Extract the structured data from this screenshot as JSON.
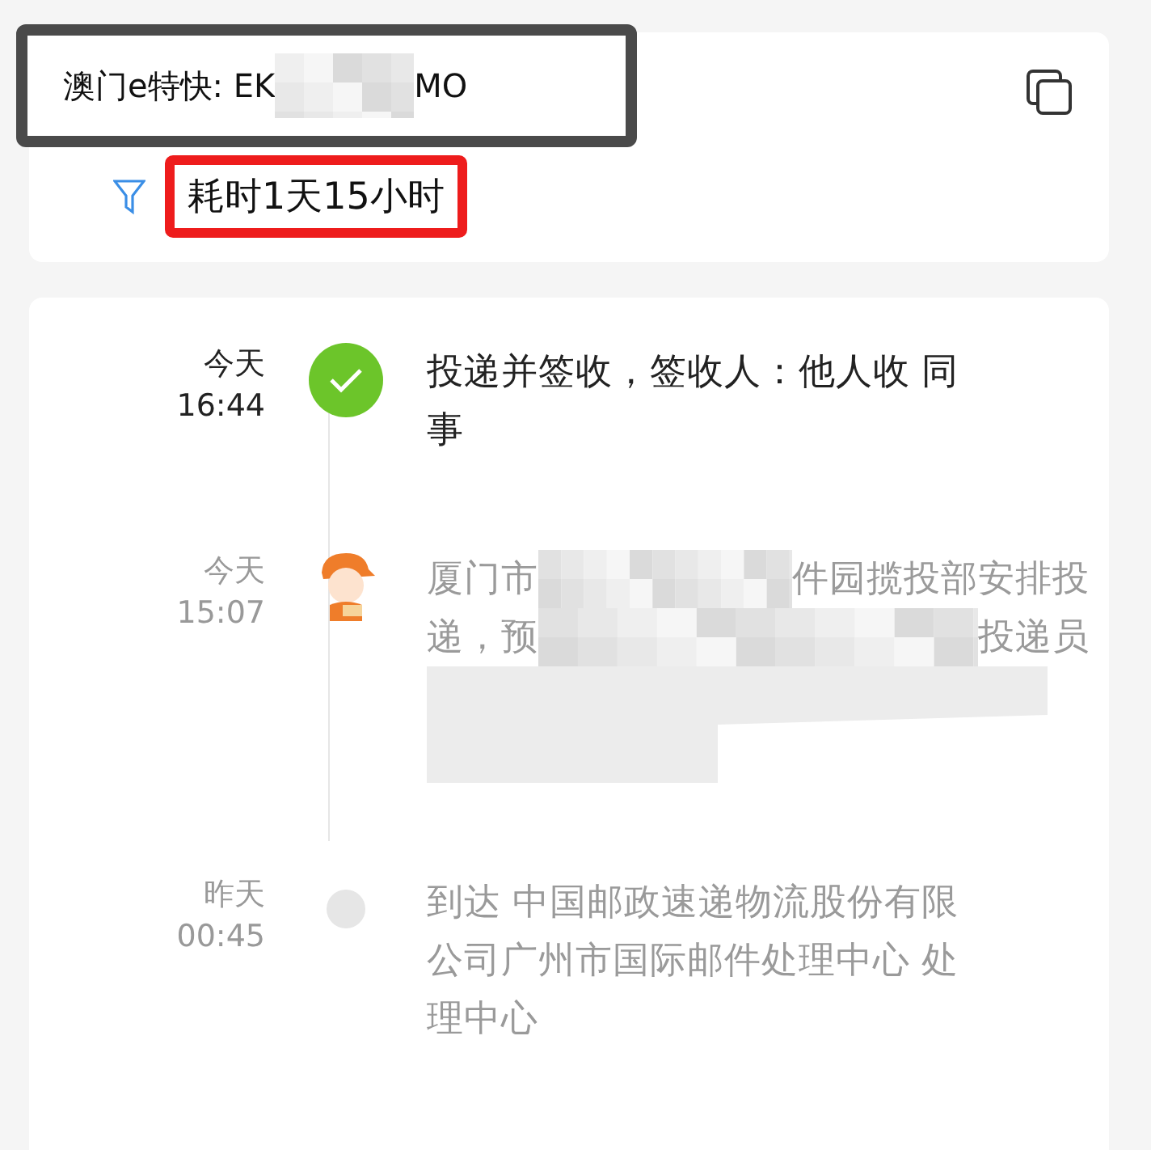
{
  "header": {
    "title_start": "澳门e特快: EK",
    "title_end": "MO",
    "duration": "耗时1天15小时"
  },
  "events": [
    {
      "kind": "delivered",
      "day": "今天",
      "time": "16:44",
      "lines": [
        [
          "投递并签收，签收人：他人收 同"
        ],
        [
          "事"
        ]
      ]
    },
    {
      "kind": "courier",
      "day": "今天",
      "time": "15:07",
      "lines": [
        [
          "厦门市",
          "件园揽投部安排投"
        ],
        [
          "递，预",
          "投递员"
        ]
      ],
      "redacted": true
    },
    {
      "kind": "dot",
      "day": "昨天",
      "time": "00:45",
      "lines": [
        [
          "到达 中国邮政速递物流股份有限"
        ],
        [
          "公司广州市国际邮件处理中心 处"
        ],
        [
          "理中心"
        ]
      ]
    }
  ]
}
